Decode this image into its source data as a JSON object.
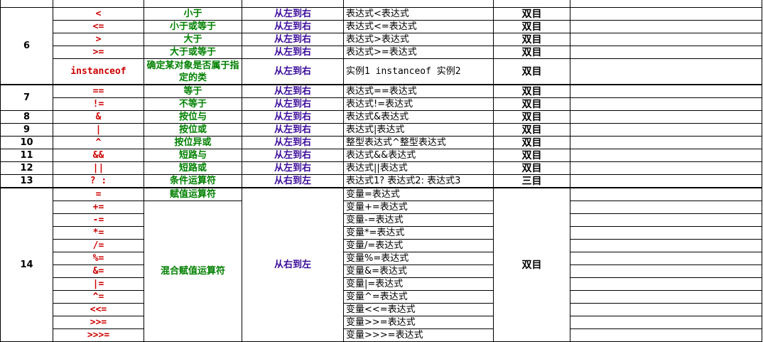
{
  "rows": [
    {
      "level": "",
      "op": "",
      "name": "",
      "assoc": "",
      "expr": "",
      "arity": ""
    },
    {
      "level": "6",
      "op": "<",
      "name": "小于",
      "assoc": "从左到右",
      "expr": "表达式<表达式",
      "arity": "双目"
    },
    {
      "level": "",
      "op": "<=",
      "name": "小于或等于",
      "assoc": "从左到右",
      "expr": "表达式<=表达式",
      "arity": "双目"
    },
    {
      "level": "",
      "op": ">",
      "name": "大于",
      "assoc": "从左到右",
      "expr": "表达式>表达式",
      "arity": "双目"
    },
    {
      "level": "",
      "op": ">=",
      "name": "大于或等于",
      "assoc": "从左到右",
      "expr": "表达式>=表达式",
      "arity": "双目"
    },
    {
      "level": "",
      "op": "instanceof",
      "name": "确定某对象是否属于指定的类",
      "assoc": "从左到右",
      "expr": "实例1 instanceof 实例2",
      "arity": "双目"
    },
    {
      "level": "7",
      "op": "==",
      "name": "等于",
      "assoc": "从左到右",
      "expr": "表达式==表达式",
      "arity": "双目"
    },
    {
      "level": "",
      "op": "!=",
      "name": "不等于",
      "assoc": "从左到右",
      "expr": "表达式!=表达式",
      "arity": "双目"
    },
    {
      "level": "8",
      "op": "&",
      "name": "按位与",
      "assoc": "从左到右",
      "expr": "表达式&表达式",
      "arity": "双目"
    },
    {
      "level": "9",
      "op": "|",
      "name": "按位或",
      "assoc": "从左到右",
      "expr": "表达式|表达式",
      "arity": "双目"
    },
    {
      "level": "10",
      "op": "^",
      "name": "按位异或",
      "assoc": "从左到右",
      "expr": "整型表达式^整型表达式",
      "arity": "双目"
    },
    {
      "level": "11",
      "op": "&&",
      "name": "短路与",
      "assoc": "从左到右",
      "expr": "表达式&&表达式",
      "arity": "双目"
    },
    {
      "level": "12",
      "op": "||",
      "name": "短路或",
      "assoc": "从左到右",
      "expr": "表达式||表达式",
      "arity": "双目"
    },
    {
      "level": "13",
      "op": "? :",
      "name": "条件运算符",
      "assoc": "从右到左",
      "expr": "表达式1? 表达式2: 表达式3",
      "arity": "三目"
    }
  ],
  "assign_group": {
    "level": "14",
    "assign_name": "赋值运算符",
    "compound_name": "混合赋值运算符",
    "assoc": "从右到左",
    "arity": "双目",
    "items": [
      {
        "op": "=",
        "expr": "变量=表达式"
      },
      {
        "op": "+=",
        "expr": "变量+=表达式"
      },
      {
        "op": "-=",
        "expr": "变量-=表达式"
      },
      {
        "op": "*=",
        "expr": "变量*=表达式"
      },
      {
        "op": "/=",
        "expr": "变量/=表达式"
      },
      {
        "op": "%=",
        "expr": "变量%=表达式"
      },
      {
        "op": "&=",
        "expr": "变量&=表达式"
      },
      {
        "op": "|=",
        "expr": "变量|=表达式"
      },
      {
        "op": "^=",
        "expr": "变量^=表达式"
      },
      {
        "op": "<<=",
        "expr": "变量<<=表达式"
      },
      {
        "op": ">>=",
        "expr": "变量>>=表达式"
      },
      {
        "op": ">>>=",
        "expr": "变量>>>=表达式"
      }
    ]
  }
}
